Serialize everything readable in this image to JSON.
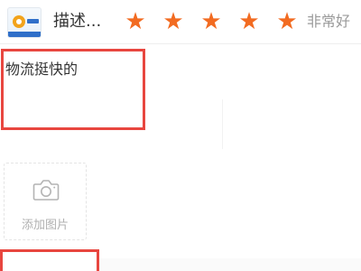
{
  "rating": {
    "label": "描述...",
    "stars": [
      "★",
      "★",
      "★",
      "★",
      "★"
    ],
    "stars_filled": 5,
    "stars_max": 5,
    "text": "非常好",
    "star_color": "#f26b21"
  },
  "comment": {
    "text": "物流挺快的"
  },
  "photo": {
    "add_label": "添加图片",
    "icon": "camera-icon"
  },
  "colors": {
    "highlight": "#e8463f",
    "text_primary": "#333333",
    "text_muted": "#9a9a9a"
  }
}
